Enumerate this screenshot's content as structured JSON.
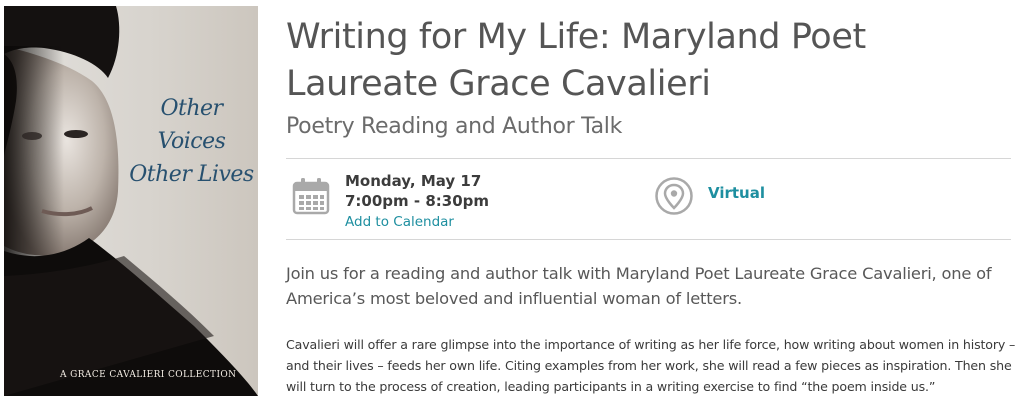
{
  "cover": {
    "title_line1": "Other Voices",
    "title_line2": "Other Lives",
    "series": "A GRACE CAVALIERI COLLECTION"
  },
  "event": {
    "title": "Writing for My Life: Maryland Poet Laureate Grace Cavalieri",
    "subtitle": "Poetry Reading and Author Talk",
    "date": "Monday, May 17",
    "time": "7:00pm - 8:30pm",
    "add_to_calendar": "Add to Calendar",
    "location": "Virtual",
    "lead": "Join us for a reading and author talk with Maryland Poet Laureate Grace Cavalieri, one of America’s most beloved and influential woman of letters.",
    "description": "Cavalieri will offer a rare glimpse into the importance of writing as her life force, how writing about women in history – and their lives – feeds her own life. Citing examples from her work, she will read a few pieces as inspiration. Then she will turn to the process of creation, leading participants in a writing exercise to find “the poem inside us.”"
  },
  "icons": {
    "calendar": "calendar-icon",
    "location": "map-pin-icon"
  },
  "colors": {
    "accent": "#1e8fa0",
    "cover_title": "#27506f",
    "icon_gray": "#a9a9a9"
  }
}
